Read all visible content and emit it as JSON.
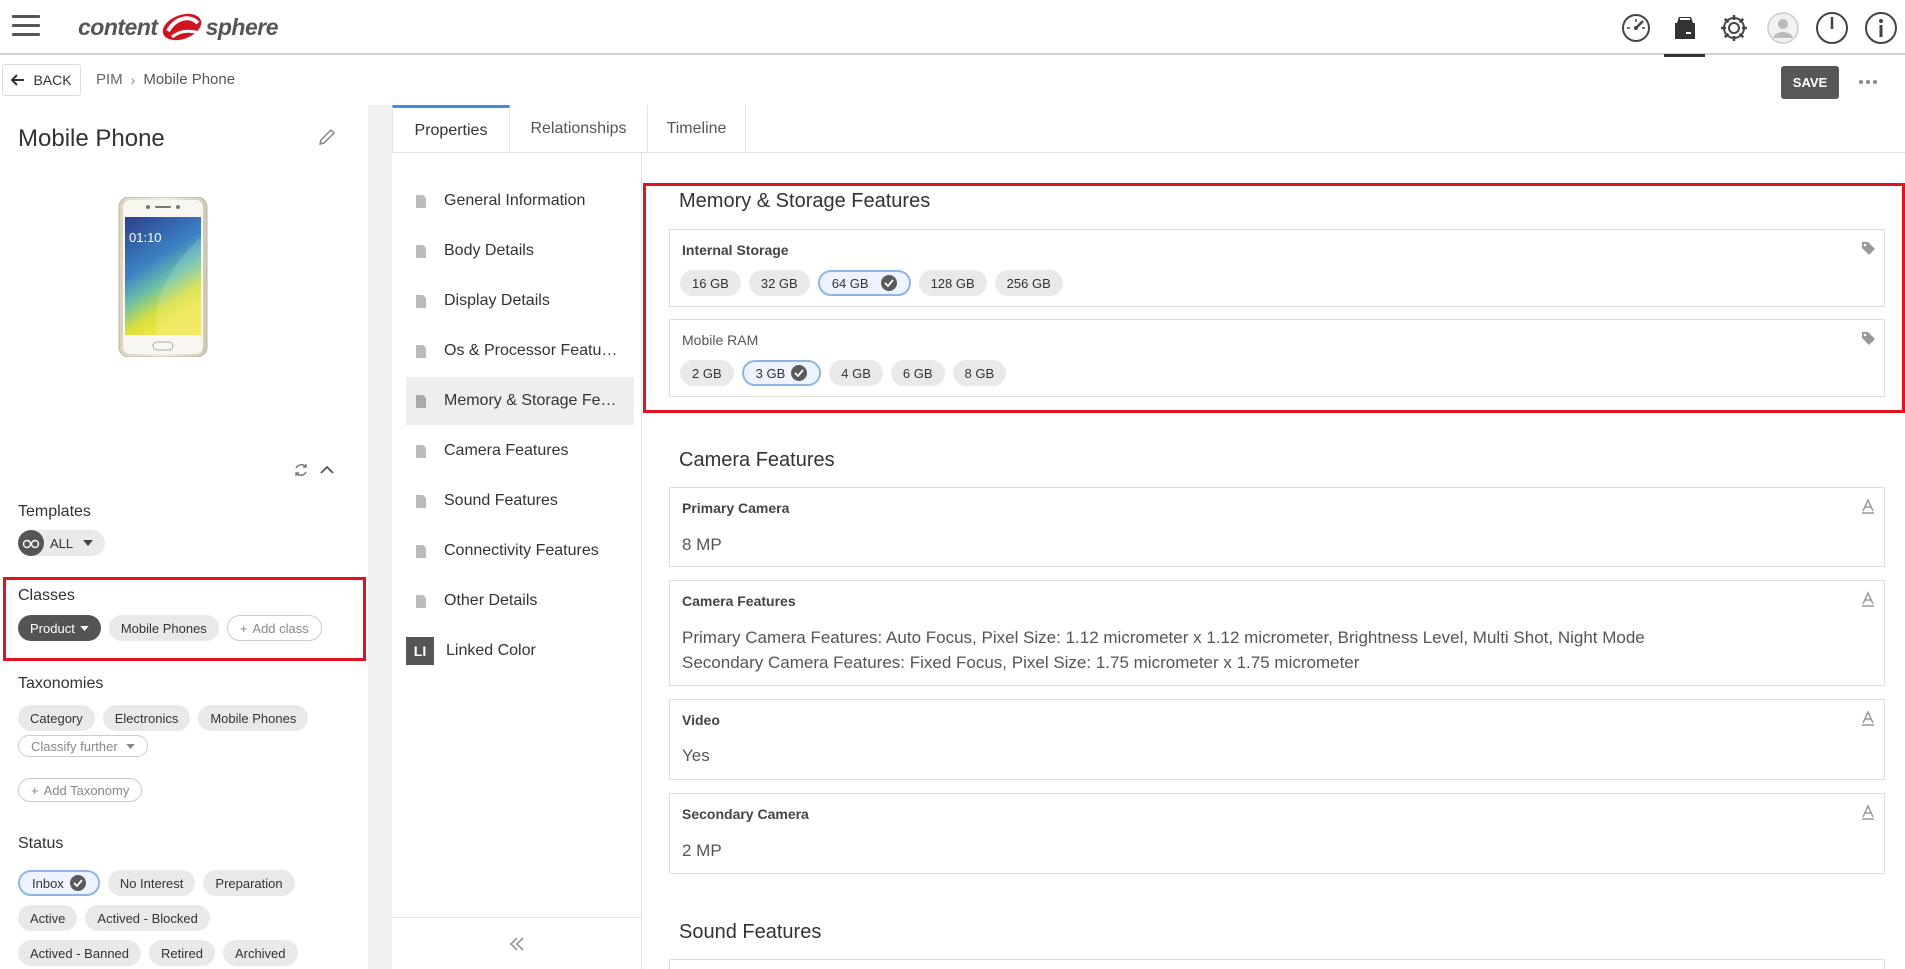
{
  "app": {
    "logo_left": "content",
    "logo_right": "sphere"
  },
  "topbar": {
    "icons": [
      "dashboard-icon",
      "product-icon",
      "settings-icon",
      "user-icon",
      "power-icon",
      "info-icon"
    ]
  },
  "subbar": {
    "back_label": "BACK",
    "breadcrumb": [
      "PIM",
      "Mobile Phone"
    ],
    "save_label": "SAVE"
  },
  "product": {
    "title": "Mobile Phone",
    "phone_time": "01:10"
  },
  "templates": {
    "title": "Templates",
    "value": "ALL"
  },
  "classes": {
    "title": "Classes",
    "items": [
      "Product",
      "Mobile Phones"
    ],
    "add_label": "Add class"
  },
  "taxonomies": {
    "title": "Taxonomies",
    "items": [
      "Category",
      "Electronics",
      "Mobile Phones"
    ],
    "classify_label": "Classify further",
    "add_label": "Add Taxonomy"
  },
  "status": {
    "title": "Status",
    "items": [
      "Inbox",
      "No Interest",
      "Preparation",
      "Active",
      "Actived - Blocked",
      "Actived - Banned",
      "Retired",
      "Archived"
    ],
    "selected": "Inbox"
  },
  "tabs": [
    "Properties",
    "Relationships",
    "Timeline"
  ],
  "nav": {
    "items": [
      "General Information",
      "Body Details",
      "Display Details",
      "Os & Processor Features",
      "Memory & Storage Features",
      "Camera Features",
      "Sound Features",
      "Connectivity Features",
      "Other Details",
      "Linked Color"
    ],
    "active": "Memory & Storage Features",
    "linked_badge": "LI"
  },
  "memory": {
    "title": "Memory & Storage Features",
    "internal_storage": {
      "label": "Internal Storage",
      "options": [
        "16 GB",
        "32 GB",
        "64 GB",
        "128 GB",
        "256 GB"
      ],
      "selected": "64 GB"
    },
    "mobile_ram": {
      "label": "Mobile RAM",
      "options": [
        "2 GB",
        "3 GB",
        "4 GB",
        "6 GB",
        "8 GB"
      ],
      "selected": "3 GB"
    }
  },
  "camera": {
    "title": "Camera Features",
    "primary": {
      "label": "Primary Camera",
      "value": "8 MP"
    },
    "features": {
      "label": "Camera Features",
      "line1": "Primary Camera Features: Auto Focus, Pixel Size: 1.12 micrometer x 1.12 micrometer, Brightness Level, Multi Shot, Night Mode",
      "line2": "Secondary Camera Features: Fixed Focus, Pixel Size: 1.75 micrometer x 1.75 micrometer"
    },
    "video": {
      "label": "Video",
      "value": "Yes"
    },
    "secondary": {
      "label": "Secondary Camera",
      "value": "2 MP"
    }
  },
  "sound": {
    "title": "Sound Features"
  },
  "colors": {
    "highlight": "#e0131f",
    "accent": "#3b8ee6",
    "logo_red": "#d0131f",
    "save_bg": "#575757"
  }
}
